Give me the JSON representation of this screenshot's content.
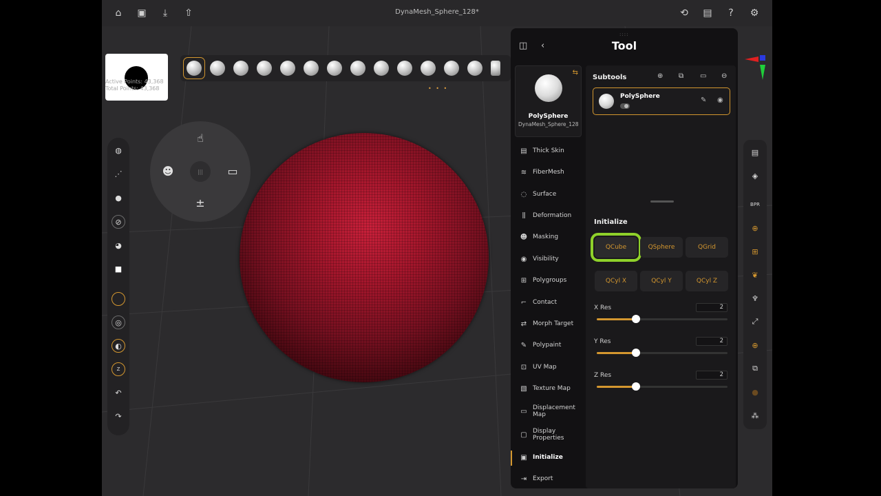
{
  "topbar": {
    "title": "DynaMesh_Sphere_128*",
    "icons_left": [
      "home-icon",
      "save-icon",
      "import-icon",
      "share-icon"
    ],
    "icons_right": [
      "history-icon",
      "layout-icon",
      "help-icon",
      "settings-icon"
    ]
  },
  "stats": {
    "active_points": "Active Points: 43,368",
    "total_points": "Total Points: 43,368"
  },
  "brushbar": {
    "selected_index": 0,
    "count": 13,
    "page_dots": "• • •"
  },
  "left_toolbar": [
    "clay-brush-icon",
    "stroke-icon",
    "alpha-icon",
    "texture-icon",
    "material-icon",
    "color-swatch-icon",
    "draw-size-icon",
    "focal-shift-icon",
    "z-intensity-icon",
    "z-add-icon",
    "undo-icon",
    "redo-icon"
  ],
  "radial_menu": {
    "top": "touch-icon",
    "left": "mask-icon",
    "right": "menu-icon",
    "bottom": "plus-minus-icon",
    "hub": "|||"
  },
  "panel": {
    "title": "Tool",
    "grip": "::::",
    "tool_card": {
      "name": "PolySphere",
      "subtitle": "DynaMesh_Sphere_128",
      "swap": "⇆"
    },
    "menu": [
      {
        "label": "Thick Skin",
        "icon": "thick-skin-icon"
      },
      {
        "label": "FiberMesh",
        "icon": "fibermesh-icon"
      },
      {
        "label": "Surface",
        "icon": "surface-icon"
      },
      {
        "label": "Deformation",
        "icon": "deformation-icon"
      },
      {
        "label": "Masking",
        "icon": "masking-icon"
      },
      {
        "label": "Visibility",
        "icon": "visibility-icon"
      },
      {
        "label": "Polygroups",
        "icon": "polygroups-icon"
      },
      {
        "label": "Contact",
        "icon": "contact-icon"
      },
      {
        "label": "Morph Target",
        "icon": "morph-target-icon"
      },
      {
        "label": "Polypaint",
        "icon": "polypaint-icon"
      },
      {
        "label": "UV Map",
        "icon": "uv-map-icon"
      },
      {
        "label": "Texture Map",
        "icon": "texture-map-icon"
      },
      {
        "label": "Displacement Map",
        "icon": "displacement-map-icon"
      },
      {
        "label": "Display Properties",
        "icon": "display-properties-icon"
      },
      {
        "label": "Initialize",
        "icon": "initialize-icon",
        "active": true
      },
      {
        "label": "Export",
        "icon": "export-icon"
      }
    ],
    "subtools": {
      "title": "Subtools",
      "item_name": "PolySphere"
    },
    "initialize": {
      "title": "Initialize",
      "buttons_row1": [
        "QCube",
        "QSphere",
        "QGrid"
      ],
      "buttons_row2": [
        "QCyl X",
        "QCyl Y",
        "QCyl Z"
      ],
      "highlighted": "QCube",
      "x_res": {
        "label": "X Res",
        "value": "2",
        "fraction": 0.3
      },
      "y_res": {
        "label": "Y Res",
        "value": "2",
        "fraction": 0.3
      },
      "z_res": {
        "label": "Z Res",
        "value": "2",
        "fraction": 0.3
      }
    }
  },
  "right_toolbar": [
    "tool-palette-icon",
    "layers-icon",
    "bpr-icon",
    "move-gizmo-icon",
    "xyz-symmetry-icon",
    "symmetry-icon",
    "transpose-icon",
    "frame-icon",
    "local-icon",
    "solo-icon",
    "material-ball-icon",
    "spotlight-icon"
  ],
  "colors": {
    "accent": "#d4972f",
    "highlight": "#8fd12a",
    "sphere": "#a3162b"
  }
}
